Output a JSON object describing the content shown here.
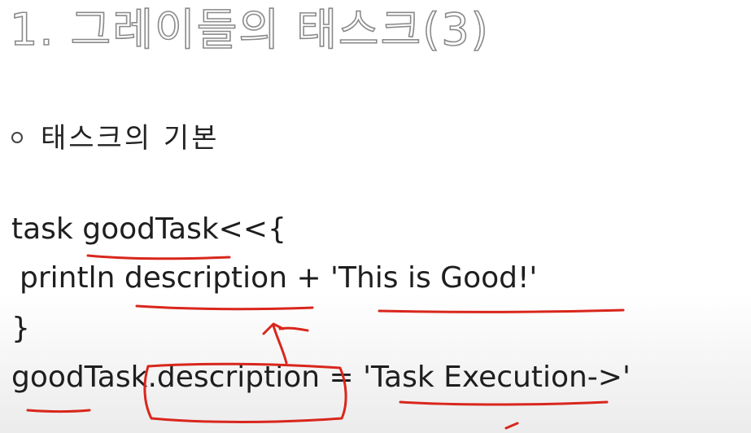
{
  "slide": {
    "title": "1. 그레이들의 태스크(3)",
    "bullet": "태스크의 기본",
    "code": {
      "line1": "task goodTask<<{",
      "line2": "println description + 'This is Good!'",
      "line3": "}",
      "line4": "goodTask.description = 'Task Execution->'"
    }
  },
  "annotation_color": "#d9261c"
}
